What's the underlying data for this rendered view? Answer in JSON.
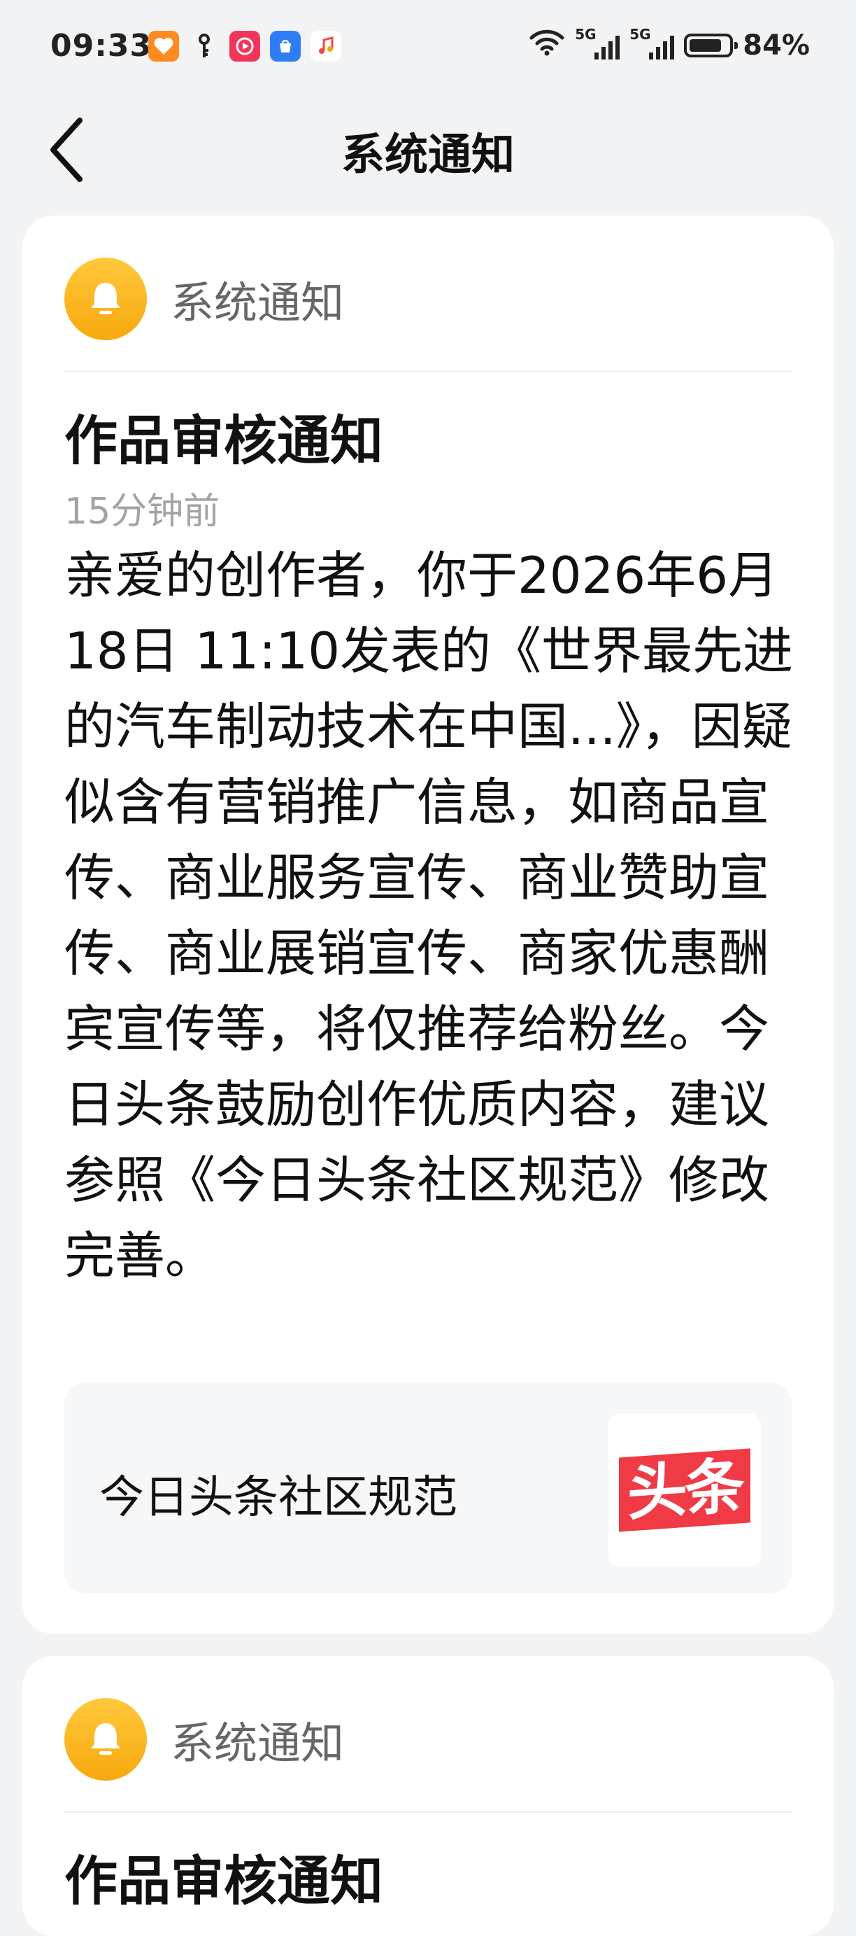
{
  "status_bar": {
    "time": "09:33",
    "network_1": "5G",
    "network_2": "5G",
    "battery_percent": "84%",
    "battery_level": 0.84,
    "app_icons": [
      "heart-app-icon",
      "key-app-icon",
      "video-app-icon",
      "app-market-icon",
      "music-app-icon"
    ]
  },
  "header": {
    "title": "系统通知"
  },
  "notifications": [
    {
      "sender": "系统通知",
      "title": "作品审核通知",
      "time": "15分钟前",
      "body": "亲爱的创作者，你于2026年6月18日 11:10发表的《世界最先进的汽车制动技术在中国...》，因疑似含有营销推广信息，如商品宣传、商业服务宣传、商业赞助宣传、商业展销宣传、商家优惠酬宾宣传等，将仅推荐给粉丝。今日头条鼓励创作优质内容，建议参照《今日头条社区规范》修改完善。",
      "link": {
        "title": "今日头条社区规范",
        "logo_text": "头条"
      }
    },
    {
      "sender": "系统通知",
      "title": "作品审核通知"
    }
  ],
  "colors": {
    "accent_bell": "#f7a80d",
    "logo_red": "#f03a45",
    "background": "#f2f3f5"
  }
}
